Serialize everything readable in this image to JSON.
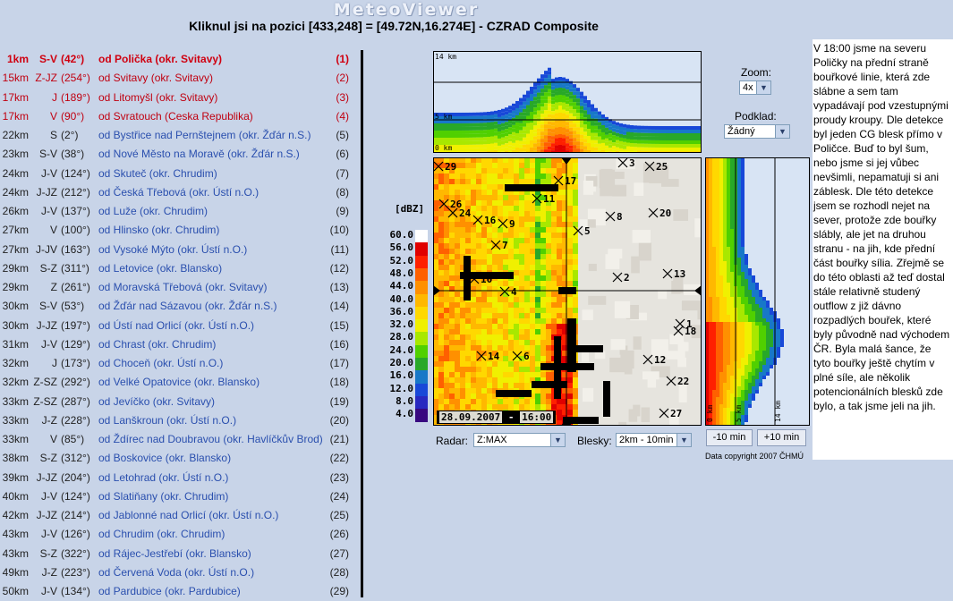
{
  "header": {
    "title": "MeteoViewer",
    "subtitle": "Kliknul jsi na pozici [433,248] = [49.72N,16.274E] - CZRAD Composite"
  },
  "locations": [
    {
      "dist": "1km",
      "dir": "S-V",
      "deg": "(42°)",
      "town": "od Polička (okr. Svitavy)",
      "num": "(1)"
    },
    {
      "dist": "15km",
      "dir": "Z-JZ",
      "deg": "(254°)",
      "town": "od Svitavy (okr. Svitavy)",
      "num": "(2)"
    },
    {
      "dist": "17km",
      "dir": "J",
      "deg": "(189°)",
      "town": "od Litomyšl (okr. Svitavy)",
      "num": "(3)"
    },
    {
      "dist": "17km",
      "dir": "V",
      "deg": "(90°)",
      "town": "od Svratouch (Ceska Republika)",
      "num": "(4)"
    },
    {
      "dist": "22km",
      "dir": "S",
      "deg": "(2°)",
      "town": "od Bystřice nad Pernštejnem (okr. Žďár n.S.)",
      "num": "(5)"
    },
    {
      "dist": "23km",
      "dir": "S-V",
      "deg": "(38°)",
      "town": "od Nové Město na Moravě (okr. Žďár n.S.)",
      "num": "(6)"
    },
    {
      "dist": "24km",
      "dir": "J-V",
      "deg": "(124°)",
      "town": "od Skuteč (okr. Chrudim)",
      "num": "(7)"
    },
    {
      "dist": "24km",
      "dir": "J-JZ",
      "deg": "(212°)",
      "town": "od Česká Třebová (okr. Ústí n.O.)",
      "num": "(8)"
    },
    {
      "dist": "26km",
      "dir": "J-V",
      "deg": "(137°)",
      "town": "od Luže (okr. Chrudim)",
      "num": "(9)"
    },
    {
      "dist": "27km",
      "dir": "V",
      "deg": "(100°)",
      "town": "od Hlinsko (okr. Chrudim)",
      "num": "(10)"
    },
    {
      "dist": "27km",
      "dir": "J-JV",
      "deg": "(163°)",
      "town": "od Vysoké Mýto (okr. Ústí n.O.)",
      "num": "(11)"
    },
    {
      "dist": "29km",
      "dir": "S-Z",
      "deg": "(311°)",
      "town": "od Letovice (okr. Blansko)",
      "num": "(12)"
    },
    {
      "dist": "29km",
      "dir": "Z",
      "deg": "(261°)",
      "town": "od Moravská Třebová (okr. Svitavy)",
      "num": "(13)"
    },
    {
      "dist": "30km",
      "dir": "S-V",
      "deg": "(53°)",
      "town": "od Žďár nad Sázavou (okr. Žďár n.S.)",
      "num": "(14)"
    },
    {
      "dist": "30km",
      "dir": "J-JZ",
      "deg": "(197°)",
      "town": "od Ústí nad Orlicí (okr. Ústí n.O.)",
      "num": "(15)"
    },
    {
      "dist": "31km",
      "dir": "J-V",
      "deg": "(129°)",
      "town": "od Chrast (okr. Chrudim)",
      "num": "(16)"
    },
    {
      "dist": "32km",
      "dir": "J",
      "deg": "(173°)",
      "town": "od Choceň (okr. Ústí n.O.)",
      "num": "(17)"
    },
    {
      "dist": "32km",
      "dir": "Z-SZ",
      "deg": "(292°)",
      "town": "od Velké Opatovice (okr. Blansko)",
      "num": "(18)"
    },
    {
      "dist": "33km",
      "dir": "Z-SZ",
      "deg": "(287°)",
      "town": "od Jevíčko (okr. Svitavy)",
      "num": "(19)"
    },
    {
      "dist": "33km",
      "dir": "J-Z",
      "deg": "(228°)",
      "town": "od Lanškroun (okr. Ústí n.O.)",
      "num": "(20)"
    },
    {
      "dist": "33km",
      "dir": "V",
      "deg": "(85°)",
      "town": "od Ždírec nad Doubravou (okr. Havlíčkův Brod)",
      "num": "(21)"
    },
    {
      "dist": "38km",
      "dir": "S-Z",
      "deg": "(312°)",
      "town": "od Boskovice (okr. Blansko)",
      "num": "(22)"
    },
    {
      "dist": "39km",
      "dir": "J-JZ",
      "deg": "(204°)",
      "town": "od Letohrad (okr. Ústí n.O.)",
      "num": "(23)"
    },
    {
      "dist": "40km",
      "dir": "J-V",
      "deg": "(124°)",
      "town": "od Slatiňany (okr. Chrudim)",
      "num": "(24)"
    },
    {
      "dist": "42km",
      "dir": "J-JZ",
      "deg": "(214°)",
      "town": "od Jablonné nad Orlicí (okr. Ústí n.O.)",
      "num": "(25)"
    },
    {
      "dist": "43km",
      "dir": "J-V",
      "deg": "(126°)",
      "town": "od Chrudim (okr. Chrudim)",
      "num": "(26)"
    },
    {
      "dist": "43km",
      "dir": "S-Z",
      "deg": "(322°)",
      "town": "od Rájec-Jestřebí (okr. Blansko)",
      "num": "(27)"
    },
    {
      "dist": "49km",
      "dir": "J-Z",
      "deg": "(223°)",
      "town": "od Červená Voda (okr. Ústí n.O.)",
      "num": "(28)"
    },
    {
      "dist": "50km",
      "dir": "J-V",
      "deg": "(134°)",
      "town": "od Pardubice (okr. Pardubice)",
      "num": "(29)"
    }
  ],
  "radar": {
    "dbz_title": "[dBZ]",
    "scale": [
      {
        "label": "60.0",
        "color": "#ffffff"
      },
      {
        "label": "56.0",
        "color": "#e00000"
      },
      {
        "label": "52.0",
        "color": "#ff2000"
      },
      {
        "label": "48.0",
        "color": "#ff6000"
      },
      {
        "label": "44.0",
        "color": "#ff9000"
      },
      {
        "label": "40.0",
        "color": "#ffb800"
      },
      {
        "label": "36.0",
        "color": "#ffd800"
      },
      {
        "label": "32.0",
        "color": "#f0f000"
      },
      {
        "label": "28.0",
        "color": "#a8e800"
      },
      {
        "label": "24.0",
        "color": "#50d000"
      },
      {
        "label": "20.0",
        "color": "#28a828"
      },
      {
        "label": "16.0",
        "color": "#1878c8"
      },
      {
        "label": "12.0",
        "color": "#1848d8"
      },
      {
        "label": "8.0",
        "color": "#2828c0"
      },
      {
        "label": "4.0",
        "color": "#380880"
      }
    ],
    "date_label": "28.09.2007",
    "time_label": "16:00",
    "profile_top_label": "14 km",
    "profile_mid_label": "5 km",
    "profile_bottom_label": "0 km",
    "side_labels": [
      "0 km",
      "5 km",
      "14 km"
    ],
    "markers": [
      {
        "n": "29"
      },
      {
        "n": "3"
      },
      {
        "n": "25"
      },
      {
        "n": "17"
      },
      {
        "n": "11"
      },
      {
        "n": "26"
      },
      {
        "n": "24"
      },
      {
        "n": "16"
      },
      {
        "n": "9"
      },
      {
        "n": "8"
      },
      {
        "n": "20"
      },
      {
        "n": "5"
      },
      {
        "n": "7"
      },
      {
        "n": "2"
      },
      {
        "n": "13"
      },
      {
        "n": "10"
      },
      {
        "n": "4"
      },
      {
        "n": "1"
      },
      {
        "n": "18"
      },
      {
        "n": "14"
      },
      {
        "n": "6"
      },
      {
        "n": "12"
      },
      {
        "n": "22"
      },
      {
        "n": "27"
      }
    ]
  },
  "controls": {
    "zoom_label": "Zoom:",
    "zoom_value": "4x",
    "podklad_label": "Podklad:",
    "podklad_value": "Žádný",
    "radar_label": "Radar:",
    "radar_value": "Z:MAX",
    "blesky_label": "Blesky:",
    "blesky_value": "2km - 10min",
    "prev_btn": "-10 min",
    "next_btn": "+10 min",
    "copyright": "Data copyright 2007 ČHMÚ"
  },
  "note": "V 18:00 jsme na severu Poličky na přední straně bouřkové linie, která zde slábne a sem tam vypadávají pod vzestupnými proudy kroupy. Dle detekce byl jeden CG blesk přímo v Poličce. Buď to byl šum, nebo jsme si jej vůbec nevšimli, nepamatuji si ani záblesk. Dle této detekce jsem se rozhodl nejet na sever, protože zde bouřky slábly, ale jet na druhou stranu - na jih, kde přední část bouřky sília. Zřejmě se do této oblasti až teď dostal stále relativně studený outflow z již dávno rozpadlých bouřek, které byly původně nad východem ČR. Byla malá šance, že tyto bouřky ještě chytím v plné síle, ale několik potencionálních blesků zde bylo, a tak jsme jeli na jih."
}
